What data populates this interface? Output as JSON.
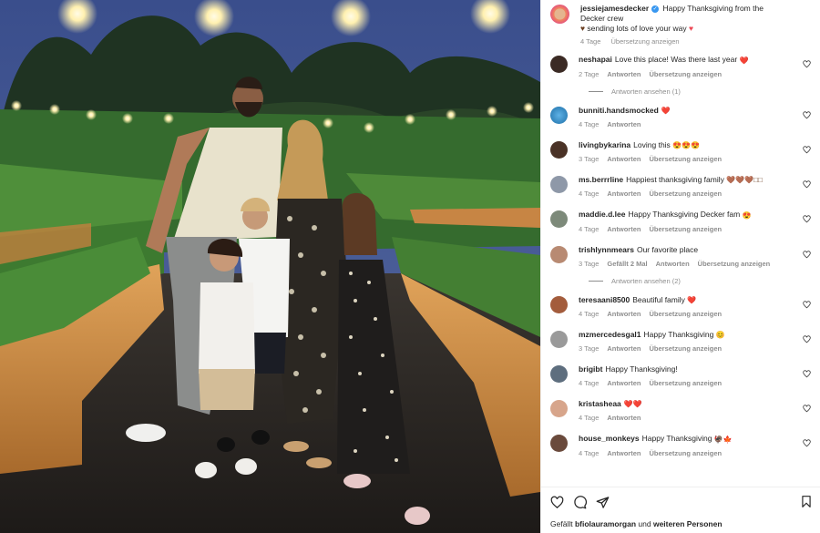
{
  "caption": {
    "username": "jessiejamesdecker",
    "verified": true,
    "text": "Happy Thanksgiving from the Decker crew",
    "text2": "sending lots of love your way",
    "time": "4 Tage",
    "translate": "Übersetzung anzeigen"
  },
  "labels": {
    "reply": "Antworten",
    "translate": "Übersetzung anzeigen"
  },
  "comments": [
    {
      "username": "neshapai",
      "text": "Love this place! Was there last year",
      "emoji": "❤️",
      "time": "2 Tage",
      "likes": "",
      "translate": true,
      "view_replies": "Antworten ansehen (1)"
    },
    {
      "username": "bunniti.handsmocked",
      "text": "",
      "emoji": "❤️",
      "time": "4 Tage",
      "likes": "",
      "translate": false,
      "view_replies": ""
    },
    {
      "username": "livingbykarina",
      "text": "Loving this",
      "emoji": "😍😍😍",
      "time": "3 Tage",
      "likes": "",
      "translate": true,
      "view_replies": ""
    },
    {
      "username": "ms.berrrline",
      "text": "Happiest thanksgiving family",
      "emoji": "🤎🤎🤎□□",
      "time": "4 Tage",
      "likes": "",
      "translate": true,
      "view_replies": ""
    },
    {
      "username": "maddie.d.lee",
      "text": "Happy Thanksgiving Decker fam",
      "emoji": "😍",
      "time": "4 Tage",
      "likes": "",
      "translate": true,
      "view_replies": ""
    },
    {
      "username": "trishlynnmears",
      "text": "Our favorite place",
      "emoji": "",
      "time": "3 Tage",
      "likes": "Gefällt 2 Mal",
      "translate": true,
      "view_replies": "Antworten ansehen (2)"
    },
    {
      "username": "teresaani8500",
      "text": "Beautiful family",
      "emoji": "❤️",
      "time": "4 Tage",
      "likes": "",
      "translate": true,
      "view_replies": ""
    },
    {
      "username": "mzmercedesgal1",
      "text": "Happy Thanksgiving",
      "emoji": "😊",
      "time": "3 Tage",
      "likes": "",
      "translate": true,
      "view_replies": ""
    },
    {
      "username": "brigibt",
      "text": "Happy Thanksgiving!",
      "emoji": "",
      "time": "4 Tage",
      "likes": "",
      "translate": true,
      "view_replies": ""
    },
    {
      "username": "kristasheaa",
      "text": "",
      "emoji": "❤️❤️",
      "time": "4 Tage",
      "likes": "",
      "translate": false,
      "view_replies": ""
    },
    {
      "username": "house_monkeys",
      "text": "Happy Thanksgiving",
      "emoji": "🦃🍁",
      "time": "4 Tage",
      "likes": "",
      "translate": true,
      "view_replies": ""
    }
  ],
  "likes_summary": {
    "prefix": "Gefällt",
    "user": "bfiolauramorgan",
    "middle": "und",
    "rest": "weiteren Personen"
  },
  "icons": {
    "like": "heart-icon",
    "comment": "speech-bubble-icon",
    "share": "paper-plane-icon",
    "save": "bookmark-icon"
  },
  "colors": {
    "heart_red": "#ed4956",
    "link_blue": "#3897f0",
    "muted": "#8e8e8e"
  }
}
